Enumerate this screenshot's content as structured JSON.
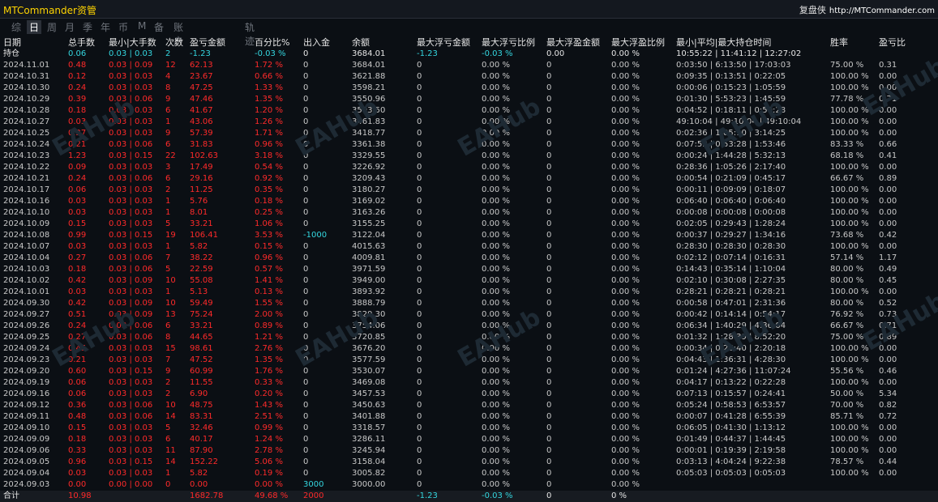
{
  "app": {
    "title": "MTCommander资管",
    "brand": "复盘侠",
    "url": "http://MTCommander.com"
  },
  "tabs": [
    {
      "label": "综",
      "active": false
    },
    {
      "label": "日",
      "active": true
    },
    {
      "label": "周",
      "active": false
    },
    {
      "label": "月",
      "active": false
    },
    {
      "label": "季",
      "active": false
    },
    {
      "label": "年",
      "active": false
    },
    {
      "label": "币",
      "active": false
    },
    {
      "label": "M",
      "active": false
    },
    {
      "label": "备",
      "active": false
    },
    {
      "label": "账户",
      "active": false
    },
    {
      "label": "轨迹",
      "active": false
    }
  ],
  "watermark": "EAHub",
  "columns": [
    "日期",
    "总手数",
    "最小|大手数",
    "次数",
    "盈亏金额",
    "百分比%",
    "出入金",
    "余额",
    "最大浮亏金额",
    "最大浮亏比例",
    "最大浮盈金额",
    "最大浮盈比例",
    "最小|平均|最大持仓时间",
    "胜率",
    "盈亏比"
  ],
  "header_row_extra": [
    "持仓",
    "0.06",
    "0.03 | 0.03",
    "2",
    "-1.23",
    "-0.03 %",
    "0",
    "3684.01",
    "-1.23",
    "-0.03 %",
    "0.00",
    "0.00 %",
    "10:55:22 | 11:41:12 | 12:27:02",
    "",
    ""
  ],
  "rows": [
    [
      "2024.11.01",
      "0.48",
      "0.03 | 0.09",
      "12",
      "62.13",
      "1.72 %",
      "0",
      "3684.01",
      "0",
      "0.00 %",
      "0",
      "0.00 %",
      "0:03:50 | 6:13:50 | 17:03:03",
      "75.00 %",
      "0.31"
    ],
    [
      "2024.10.31",
      "0.12",
      "0.03 | 0.03",
      "4",
      "23.67",
      "0.66 %",
      "0",
      "3621.88",
      "0",
      "0.00 %",
      "0",
      "0.00 %",
      "0:09:35 | 0:13:51 | 0:22:05",
      "100.00 %",
      "0.00"
    ],
    [
      "2024.10.30",
      "0.24",
      "0.03 | 0.03",
      "8",
      "47.25",
      "1.33 %",
      "0",
      "3598.21",
      "0",
      "0.00 %",
      "0",
      "0.00 %",
      "0:00:06 | 0:15:23 | 1:05:59",
      "100.00 %",
      "0.00"
    ],
    [
      "2024.10.29",
      "0.39",
      "0.03 | 0.06",
      "9",
      "47.46",
      "1.35 %",
      "0",
      "3550.96",
      "0",
      "0.00 %",
      "0",
      "0.00 %",
      "0:01:30 | 5:53:23 | 1:45:59",
      "77.78 %",
      "0.71"
    ],
    [
      "2024.10.28",
      "0.18",
      "0.03 | 0.03",
      "6",
      "41.67",
      "1.20 %",
      "0",
      "3503.50",
      "0",
      "0.00 %",
      "0",
      "0.00 %",
      "0:04:52 | 0:18:11 | 0:50:28",
      "100.00 %",
      "0.00"
    ],
    [
      "2024.10.27",
      "0.03",
      "0.03 | 0.03",
      "1",
      "43.06",
      "1.26 %",
      "0",
      "3461.83",
      "0",
      "0.00 %",
      "0",
      "0.00 %",
      "49:10:04 | 49:10:04 | 49:10:04",
      "100.00 %",
      "0.00"
    ],
    [
      "2024.10.25",
      "0.27",
      "0.03 | 0.03",
      "9",
      "57.39",
      "1.71 %",
      "0",
      "3418.77",
      "0",
      "0.00 %",
      "0",
      "0.00 %",
      "0:02:36 | 1:05:10 | 3:14:25",
      "100.00 %",
      "0.00"
    ],
    [
      "2024.10.24",
      "0.21",
      "0.03 | 0.06",
      "6",
      "31.83",
      "0.96 %",
      "0",
      "3361.38",
      "0",
      "0.00 %",
      "0",
      "0.00 %",
      "0:07:53 | 0:53:28 | 1:53:46",
      "83.33 %",
      "0.66"
    ],
    [
      "2024.10.23",
      "1.23",
      "0.03 | 0.15",
      "22",
      "102.63",
      "3.18 %",
      "0",
      "3329.55",
      "0",
      "0.00 %",
      "0",
      "0.00 %",
      "0:00:24 | 1:44:28 | 5:32:13",
      "68.18 %",
      "0.41"
    ],
    [
      "2024.10.22",
      "0.09",
      "0.03 | 0.03",
      "3",
      "17.49",
      "0.54 %",
      "0",
      "3226.92",
      "0",
      "0.00 %",
      "0",
      "0.00 %",
      "0:28:36 | 1:05:26 | 2:17:40",
      "100.00 %",
      "0.00"
    ],
    [
      "2024.10.21",
      "0.24",
      "0.03 | 0.06",
      "6",
      "29.16",
      "0.92 %",
      "0",
      "3209.43",
      "0",
      "0.00 %",
      "0",
      "0.00 %",
      "0:00:54 | 0:21:09 | 0:45:17",
      "66.67 %",
      "0.89"
    ],
    [
      "2024.10.17",
      "0.06",
      "0.03 | 0.03",
      "2",
      "11.25",
      "0.35 %",
      "0",
      "3180.27",
      "0",
      "0.00 %",
      "0",
      "0.00 %",
      "0:00:11 | 0:09:09 | 0:18:07",
      "100.00 %",
      "0.00"
    ],
    [
      "2024.10.16",
      "0.03",
      "0.03 | 0.03",
      "1",
      "5.76",
      "0.18 %",
      "0",
      "3169.02",
      "0",
      "0.00 %",
      "0",
      "0.00 %",
      "0:06:40 | 0:06:40 | 0:06:40",
      "100.00 %",
      "0.00"
    ],
    [
      "2024.10.10",
      "0.03",
      "0.03 | 0.03",
      "1",
      "8.01",
      "0.25 %",
      "0",
      "3163.26",
      "0",
      "0.00 %",
      "0",
      "0.00 %",
      "0:00:08 | 0:00:08 | 0:00:08",
      "100.00 %",
      "0.00"
    ],
    [
      "2024.10.09",
      "0.15",
      "0.03 | 0.03",
      "5",
      "33.21",
      "1.06 %",
      "0",
      "3155.25",
      "0",
      "0.00 %",
      "0",
      "0.00 %",
      "0:02:05 | 0:29:43 | 1:28:24",
      "100.00 %",
      "0.00"
    ],
    [
      "2024.10.08",
      "0.99",
      "0.03 | 0.15",
      "19",
      "106.41",
      "3.53 %",
      "-1000",
      "3122.04",
      "0",
      "0.00 %",
      "0",
      "0.00 %",
      "0:00:37 | 0:29:27 | 1:34:16",
      "73.68 %",
      "0.42"
    ],
    [
      "2024.10.07",
      "0.03",
      "0.03 | 0.03",
      "1",
      "5.82",
      "0.15 %",
      "0",
      "4015.63",
      "0",
      "0.00 %",
      "0",
      "0.00 %",
      "0:28:30 | 0:28:30 | 0:28:30",
      "100.00 %",
      "0.00"
    ],
    [
      "2024.10.04",
      "0.27",
      "0.03 | 0.06",
      "7",
      "38.22",
      "0.96 %",
      "0",
      "4009.81",
      "0",
      "0.00 %",
      "0",
      "0.00 %",
      "0:02:12 | 0:07:14 | 0:16:31",
      "57.14 %",
      "1.17"
    ],
    [
      "2024.10.03",
      "0.18",
      "0.03 | 0.06",
      "5",
      "22.59",
      "0.57 %",
      "0",
      "3971.59",
      "0",
      "0.00 %",
      "0",
      "0.00 %",
      "0:14:43 | 0:35:14 | 1:10:04",
      "80.00 %",
      "0.49"
    ],
    [
      "2024.10.02",
      "0.42",
      "0.03 | 0.09",
      "10",
      "55.08",
      "1.41 %",
      "0",
      "3949.00",
      "0",
      "0.00 %",
      "0",
      "0.00 %",
      "0:02:10 | 0:30:08 | 2:27:35",
      "80.00 %",
      "0.45"
    ],
    [
      "2024.10.01",
      "0.03",
      "0.03 | 0.03",
      "1",
      "5.13",
      "0.13 %",
      "0",
      "3893.92",
      "0",
      "0.00 %",
      "0",
      "0.00 %",
      "0:28:21 | 0:28:21 | 0:28:21",
      "100.00 %",
      "0.00"
    ],
    [
      "2024.09.30",
      "0.42",
      "0.03 | 0.09",
      "10",
      "59.49",
      "1.55 %",
      "0",
      "3888.79",
      "0",
      "0.00 %",
      "0",
      "0.00 %",
      "0:00:58 | 0:47:01 | 2:31:36",
      "80.00 %",
      "0.52"
    ],
    [
      "2024.09.27",
      "0.51",
      "0.03 | 0.09",
      "13",
      "75.24",
      "2.00 %",
      "0",
      "3829.30",
      "0",
      "0.00 %",
      "0",
      "0.00 %",
      "0:00:42 | 0:14:14 | 0:54:17",
      "76.92 %",
      "0.73"
    ],
    [
      "2024.09.26",
      "0.24",
      "0.03 | 0.06",
      "6",
      "33.21",
      "0.89 %",
      "0",
      "3754.06",
      "0",
      "0.00 %",
      "0",
      "0.00 %",
      "0:06:34 | 1:40:29 | 4:36:04",
      "66.67 %",
      "0.71"
    ],
    [
      "2024.09.25",
      "0.27",
      "0.03 | 0.06",
      "8",
      "44.65",
      "1.21 %",
      "0",
      "3720.85",
      "0",
      "0.00 %",
      "0",
      "0.00 %",
      "0:01:32 | 1:28:39 | 8:52:20",
      "75.00 %",
      "0.89"
    ],
    [
      "2024.09.24",
      "0.45",
      "0.03 | 0.03",
      "15",
      "98.61",
      "2.76 %",
      "0",
      "3676.20",
      "0",
      "0.00 %",
      "0",
      "0.00 %",
      "0:00:34 | 0:26:40 | 2:20:18",
      "100.00 %",
      "0.00"
    ],
    [
      "2024.09.23",
      "0.21",
      "0.03 | 0.03",
      "7",
      "47.52",
      "1.35 %",
      "0",
      "3577.59",
      "0",
      "0.00 %",
      "0",
      "0.00 %",
      "0:04:43 | 1:36:31 | 4:28:30",
      "100.00 %",
      "0.00"
    ],
    [
      "2024.09.20",
      "0.60",
      "0.03 | 0.15",
      "9",
      "60.99",
      "1.76 %",
      "0",
      "3530.07",
      "0",
      "0.00 %",
      "0",
      "0.00 %",
      "0:01:24 | 4:27:36 | 11:07:24",
      "55.56 %",
      "0.46"
    ],
    [
      "2024.09.19",
      "0.06",
      "0.03 | 0.03",
      "2",
      "11.55",
      "0.33 %",
      "0",
      "3469.08",
      "0",
      "0.00 %",
      "0",
      "0.00 %",
      "0:04:17 | 0:13:22 | 0:22:28",
      "100.00 %",
      "0.00"
    ],
    [
      "2024.09.16",
      "0.06",
      "0.03 | 0.03",
      "2",
      "6.90",
      "0.20 %",
      "0",
      "3457.53",
      "0",
      "0.00 %",
      "0",
      "0.00 %",
      "0:07:13 | 0:15:57 | 0:24:41",
      "50.00 %",
      "5.34"
    ],
    [
      "2024.09.12",
      "0.36",
      "0.03 | 0.06",
      "10",
      "48.75",
      "1.43 %",
      "0",
      "3450.63",
      "0",
      "0.00 %",
      "0",
      "0.00 %",
      "0:05:24 | 0:58:53 | 6:53:57",
      "70.00 %",
      "0.82"
    ],
    [
      "2024.09.11",
      "0.48",
      "0.03 | 0.06",
      "14",
      "83.31",
      "2.51 %",
      "0",
      "3401.88",
      "0",
      "0.00 %",
      "0",
      "0.00 %",
      "0:00:07 | 0:41:28 | 6:55:39",
      "85.71 %",
      "0.72"
    ],
    [
      "2024.09.10",
      "0.15",
      "0.03 | 0.03",
      "5",
      "32.46",
      "0.99 %",
      "0",
      "3318.57",
      "0",
      "0.00 %",
      "0",
      "0.00 %",
      "0:06:05 | 0:41:30 | 1:13:12",
      "100.00 %",
      "0.00"
    ],
    [
      "2024.09.09",
      "0.18",
      "0.03 | 0.03",
      "6",
      "40.17",
      "1.24 %",
      "0",
      "3286.11",
      "0",
      "0.00 %",
      "0",
      "0.00 %",
      "0:01:49 | 0:44:37 | 1:44:45",
      "100.00 %",
      "0.00"
    ],
    [
      "2024.09.06",
      "0.33",
      "0.03 | 0.03",
      "11",
      "87.90",
      "2.78 %",
      "0",
      "3245.94",
      "0",
      "0.00 %",
      "0",
      "0.00 %",
      "0:00:01 | 0:19:39 | 2:19:58",
      "100.00 %",
      "0.00"
    ],
    [
      "2024.09.05",
      "0.96",
      "0.03 | 0.15",
      "14",
      "152.22",
      "5.06 %",
      "0",
      "3158.04",
      "0",
      "0.00 %",
      "0",
      "0.00 %",
      "0:03:13 | 4:04:24 | 9:22:38",
      "78.57 %",
      "0.44"
    ],
    [
      "2024.09.04",
      "0.03",
      "0.03 | 0.03",
      "1",
      "5.82",
      "0.19 %",
      "0",
      "3005.82",
      "0",
      "0.00 %",
      "0",
      "0.00 %",
      "0:05:03 | 0:05:03 | 0:05:03",
      "100.00 %",
      "0.00"
    ],
    [
      "2024.09.03",
      "0.00",
      "0.00 | 0.00",
      "0",
      "0.00",
      "0.00 %",
      "3000",
      "3000.00",
      "0",
      "0.00 %",
      "0",
      "0.00 %",
      "",
      "",
      ""
    ]
  ],
  "totals": [
    "合计",
    "10.98",
    "",
    "",
    "1682.78",
    "49.68 %",
    "2000",
    "",
    "-1.23",
    "-0.03 %",
    "0",
    "0 %",
    "",
    "",
    ""
  ],
  "colors": {
    "loss_red": "#ff2a2a",
    "accent_cyan": "#34d7e0",
    "title_yellow": "#ffd400",
    "background": "#0b0f14"
  }
}
